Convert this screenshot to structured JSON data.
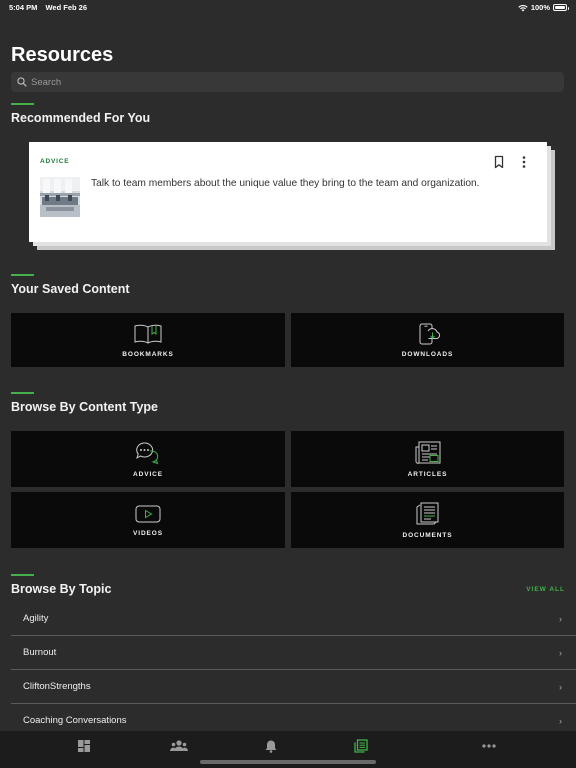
{
  "status_bar": {
    "time": "5:04 PM",
    "date": "Wed Feb 26",
    "battery": "100%",
    "battery_level": 1.0
  },
  "page": {
    "title": "Resources"
  },
  "search": {
    "placeholder": "Search",
    "icon": "search-icon"
  },
  "recommended": {
    "title": "Recommended For You",
    "card": {
      "tag": "ADVICE",
      "text": "Talk to team members about the unique value they bring to the team and organization.",
      "bookmark_icon": "bookmark-icon",
      "more_icon": "more-vertical-icon"
    }
  },
  "saved": {
    "title": "Your Saved Content",
    "tiles": [
      {
        "label": "BOOKMARKS",
        "icon": "book-icon"
      },
      {
        "label": "DOWNLOADS",
        "icon": "download-device-icon"
      }
    ]
  },
  "content_types": {
    "title": "Browse By Content Type",
    "tiles": [
      {
        "label": "ADVICE",
        "icon": "chat-bubbles-icon"
      },
      {
        "label": "ARTICLES",
        "icon": "newspaper-icon"
      },
      {
        "label": "VIDEOS",
        "icon": "play-icon"
      },
      {
        "label": "DOCUMENTS",
        "icon": "documents-icon"
      }
    ]
  },
  "topics": {
    "title": "Browse By Topic",
    "view_all": "VIEW ALL",
    "items": [
      {
        "label": "Agility"
      },
      {
        "label": "Burnout"
      },
      {
        "label": "CliftonStrengths"
      },
      {
        "label": "Coaching Conversations"
      }
    ]
  },
  "tab_bar": {
    "tabs": [
      {
        "icon": "dashboard-icon",
        "active": false
      },
      {
        "icon": "team-icon",
        "active": false
      },
      {
        "icon": "bell-icon",
        "active": false
      },
      {
        "icon": "resources-icon",
        "active": true
      },
      {
        "icon": "more-icon",
        "active": false
      }
    ]
  },
  "colors": {
    "background": "#2c2c2c",
    "accent": "#43b049",
    "tile": "#0a0a0a",
    "tab_bar": "#1c1c1c"
  }
}
